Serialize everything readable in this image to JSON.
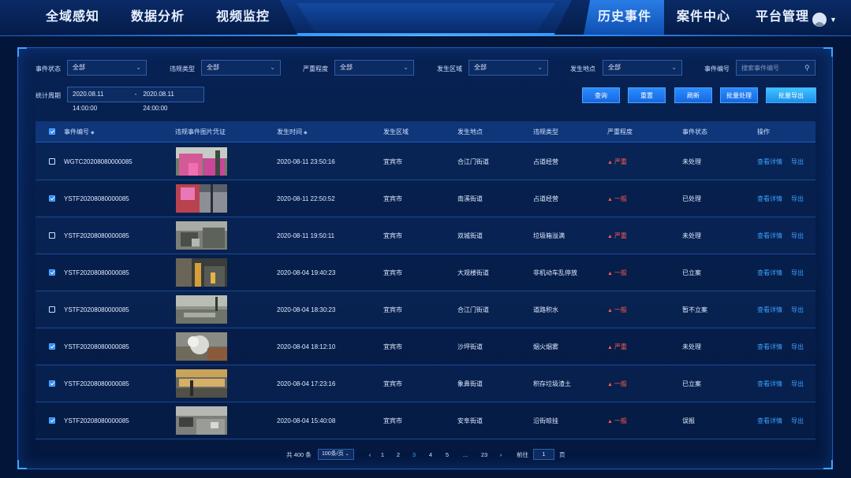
{
  "nav": {
    "left": [
      "全域感知",
      "数据分析",
      "视频监控"
    ],
    "right": [
      "历史事件",
      "案件中心",
      "平台管理"
    ],
    "active": "历史事件"
  },
  "filters": {
    "event_status": {
      "label": "事件状态",
      "value": "全部"
    },
    "violation_type": {
      "label": "违规类型",
      "value": "全部"
    },
    "severity": {
      "label": "严重程度",
      "value": "全部"
    },
    "area": {
      "label": "发生区域",
      "value": "全部"
    },
    "location": {
      "label": "发生地点",
      "value": "全部"
    },
    "event_no": {
      "label": "事件编号",
      "placeholder": "搜索事件编号"
    },
    "period": {
      "label": "统计周期",
      "start": "2020.08.11 14:00:00",
      "sep": "-",
      "end": "2020.08.11 24:00:00"
    }
  },
  "buttons": {
    "query": "查询",
    "reset": "重置",
    "refresh": "刷新",
    "batch_process": "批量处理",
    "batch_export": "批量导出"
  },
  "table": {
    "headers": {
      "event_no": "事件编号",
      "photo": "违规事件图片凭证",
      "time": "发生时间",
      "area": "发生区域",
      "location": "发生地点",
      "type": "违规类型",
      "severity": "严重程度",
      "status": "事件状态",
      "ops": "操作"
    },
    "rows": [
      {
        "checked": false,
        "no": "WGTC20208080000085",
        "time": "2020-08-11 23:50:16",
        "area": "宜宾市",
        "location": "合江门街道",
        "type": "占道经营",
        "severity": "严重",
        "status": "未处理"
      },
      {
        "checked": true,
        "no": "YSTF20208080000085",
        "time": "2020-08-11 22:50:52",
        "area": "宜宾市",
        "location": "南溪街道",
        "type": "占道经营",
        "severity": "一般",
        "status": "已处理"
      },
      {
        "checked": false,
        "no": "YSTF20208080000085",
        "time": "2020-08-11 19:50:11",
        "area": "宜宾市",
        "location": "双城街道",
        "type": "垃圾箱溢满",
        "severity": "严重",
        "status": "未处理"
      },
      {
        "checked": true,
        "no": "YSTF20208080000085",
        "time": "2020-08-04 19:40:23",
        "area": "宜宾市",
        "location": "大观楼街道",
        "type": "非机动车乱停放",
        "severity": "一般",
        "status": "已立案"
      },
      {
        "checked": false,
        "no": "YSTF20208080000085",
        "time": "2020-08-04 18:30:23",
        "area": "宜宾市",
        "location": "合江门街道",
        "type": "道路积水",
        "severity": "一般",
        "status": "暂不立案"
      },
      {
        "checked": true,
        "no": "YSTF20208080000085",
        "time": "2020-08-04 18:12:10",
        "area": "宜宾市",
        "location": "沙坪街道",
        "type": "烟火烟雾",
        "severity": "严重",
        "status": "未处理"
      },
      {
        "checked": true,
        "no": "YSTF20208080000085",
        "time": "2020-08-04 17:23:16",
        "area": "宜宾市",
        "location": "象鼻街道",
        "type": "积存垃圾渣土",
        "severity": "一般",
        "status": "已立案"
      },
      {
        "checked": true,
        "no": "YSTF20208080000085",
        "time": "2020-08-04 15:40:08",
        "area": "宜宾市",
        "location": "安阜街道",
        "type": "沿街晾挂",
        "severity": "一般",
        "status": "误报"
      }
    ],
    "op_detail": "查看详情",
    "op_export": "导出"
  },
  "pagination": {
    "total_prefix": "共",
    "total": "400",
    "total_suffix": "条",
    "page_size": "100条/页",
    "prev": "‹",
    "next": "›",
    "pages": [
      "1",
      "2",
      "3",
      "4",
      "5",
      "...",
      "23"
    ],
    "current": "3",
    "goto_label": "前往",
    "goto_value": "1",
    "goto_suffix": "页"
  },
  "colors": {
    "accent": "#2d8cff",
    "severe": "#ff5a4e",
    "link": "#39a3ff",
    "background": "#03163a"
  },
  "icons": {
    "search": "search-icon",
    "dropdown": "chevron-down-icon",
    "sort": "sort-icon",
    "warning": "warning-triangle-icon",
    "avatar": "user-avatar-icon"
  }
}
